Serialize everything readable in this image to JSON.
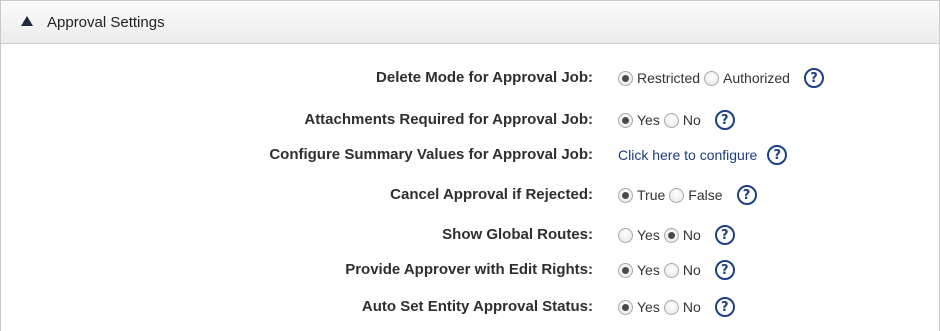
{
  "section": {
    "title": "Approval Settings"
  },
  "settings": [
    {
      "label": "Delete Mode for Approval Job:",
      "options": [
        "Restricted",
        "Authorized"
      ],
      "selected": "Restricted"
    },
    {
      "label": "Attachments Required for Approval Job:",
      "options": [
        "Yes",
        "No"
      ],
      "selected": "Yes"
    },
    {
      "label": "Configure Summary Values for Approval Job:",
      "link": "Click here to configure"
    },
    {
      "label": "Cancel Approval if Rejected:",
      "options": [
        "True",
        "False"
      ],
      "selected": "True"
    },
    {
      "label": "Show Global Routes:",
      "options": [
        "Yes",
        "No"
      ],
      "selected": "No"
    },
    {
      "label": "Provide Approver with Edit Rights:",
      "options": [
        "Yes",
        "No"
      ],
      "selected": "Yes"
    },
    {
      "label": "Auto Set Entity Approval Status:",
      "options": [
        "Yes",
        "No"
      ],
      "selected": "Yes"
    }
  ],
  "help_glyph": "?",
  "colors": {
    "accent": "#1c3f86",
    "header_bg": "#ececec"
  }
}
